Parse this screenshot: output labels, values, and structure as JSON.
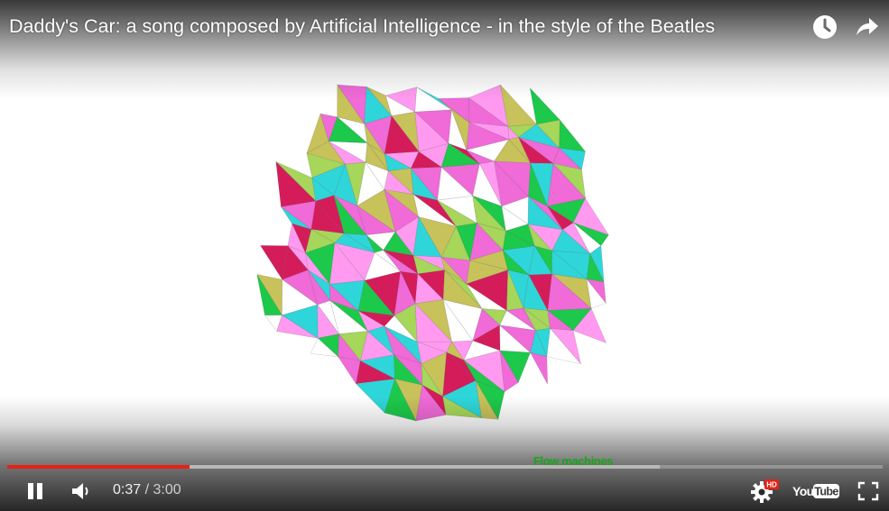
{
  "video": {
    "title": "Daddy's Car: a song composed by Artificial Intelligence - in the style of the Beatles",
    "watermark": "Flow machines"
  },
  "playback": {
    "current_time": "0:37",
    "separator": " / ",
    "duration": "3:00",
    "progress_fraction": 0.208,
    "buffered_fraction": 0.745
  },
  "logo": {
    "you": "You",
    "tube": "Tube"
  },
  "settings": {
    "hd_badge": "HD"
  },
  "icons": {
    "watch_later": "clock-icon",
    "share": "share-arrow-icon",
    "pause": "pause-icon",
    "volume": "volume-icon",
    "settings": "gear-icon",
    "fullscreen": "fullscreen-icon"
  },
  "colors": {
    "progress_played": "#e62117",
    "watermark": "#1aa51a",
    "palette": [
      "#f06ad8",
      "#2ed6d9",
      "#1cc94a",
      "#c7c25a",
      "#d41c5a",
      "#ffffff",
      "#ff9af0",
      "#a6d65a"
    ]
  }
}
